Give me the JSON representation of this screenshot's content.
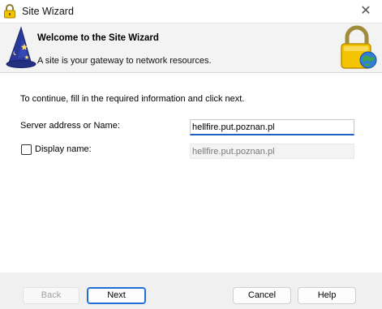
{
  "window": {
    "title": "Site Wizard",
    "close_glyph": "✕",
    "icon": "lock-icon"
  },
  "header": {
    "title": "Welcome to the Site Wizard",
    "subtitle": "A site is your gateway to network resources.",
    "left_icon": "wizard-hat-icon",
    "right_icon": "lock-globe-icon"
  },
  "form": {
    "intro": "To continue, fill in the required information and click next.",
    "server_label": "Server address or Name:",
    "server_value": "hellfire.put.poznan.pl",
    "display_label": "Display name:",
    "display_value": "hellfire.put.poznan.pl",
    "display_checked": false
  },
  "buttons": {
    "back": "Back",
    "next": "Next",
    "cancel": "Cancel",
    "help": "Help"
  },
  "colors": {
    "accent": "#1f6fd6",
    "header_bg": "#f3f3f3",
    "content_bg": "#ffffff",
    "footer_bg": "#f0f0f0"
  }
}
